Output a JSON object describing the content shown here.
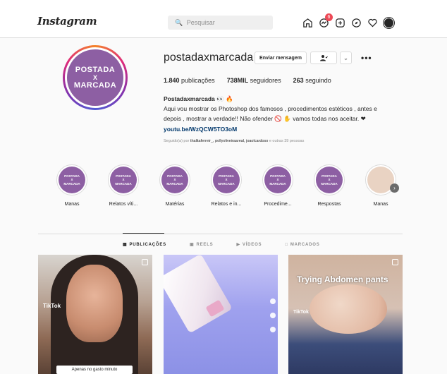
{
  "header": {
    "logo": "Instagram",
    "search_placeholder": "Pesquisar",
    "notification_count": "6"
  },
  "profile": {
    "username": "postadaxmarcada",
    "avatar_lines": [
      "POSTADA",
      "X",
      "MARCADA"
    ],
    "buttons": {
      "message": "Enviar mensagem",
      "caret": "⌄",
      "more": "•••"
    },
    "stats": {
      "posts_value": "1.840",
      "posts_label": "publicações",
      "followers_value": "738MIL",
      "followers_label": "seguidores",
      "following_value": "263",
      "following_label": "seguindo"
    },
    "bio": {
      "name": "Postadaxmarcada 👀 🔥",
      "line1": "Aqui vou mostrar os Photoshop dos famosos , procedimentos estéticos , antes e",
      "line2": "depois , mostrar a verdade!! Não ofender 🚫 ✋ vamos todas nos aceitar. ❤",
      "link": "youtu.be/WzQCW5TO3oM",
      "followed_prefix": "Seguido(a) por",
      "followed_names": "thalitaferreir_, pollyoliveiraareal, joaolcardoso",
      "followed_suffix": "e outras 39 pessoas"
    }
  },
  "highlights": [
    {
      "label": "Manas",
      "cover": [
        "POSTADA",
        "X",
        "MARCADA"
      ]
    },
    {
      "label": "Relatos víti...",
      "cover": [
        "POSTADA",
        "X",
        "MARCADA"
      ]
    },
    {
      "label": "Matérias",
      "cover": [
        "POSTADA",
        "X",
        "MARCADA"
      ]
    },
    {
      "label": "Relatos e in...",
      "cover": [
        "POSTADA",
        "X",
        "MARCADA"
      ]
    },
    {
      "label": "Procedime...",
      "cover": [
        "POSTADA",
        "X",
        "MARCADA"
      ]
    },
    {
      "label": "Respostas",
      "cover": [
        "POSTADA",
        "X",
        "MARCADA"
      ]
    },
    {
      "label": "Manas",
      "cover": []
    }
  ],
  "tabs": [
    {
      "label": "PUBLICAÇÕES",
      "icon": "grid-icon",
      "active": true
    },
    {
      "label": "REELS",
      "icon": "reels-icon",
      "active": false
    },
    {
      "label": "VÍDEOS",
      "icon": "video-icon",
      "active": false
    },
    {
      "label": "MARCADOS",
      "icon": "tagged-icon",
      "active": false
    }
  ],
  "posts": [
    {
      "caption": "Apenas no gasto minuto",
      "watermark": "TikTok"
    },
    {
      "caption": "",
      "watermark": ""
    },
    {
      "caption": "",
      "overlay_title": "Trying Abdomen pants",
      "watermark": "TikTok"
    }
  ],
  "colors": {
    "brand_purple": "#8d5fa3",
    "link": "#00376b",
    "badge": "#ed4956"
  }
}
